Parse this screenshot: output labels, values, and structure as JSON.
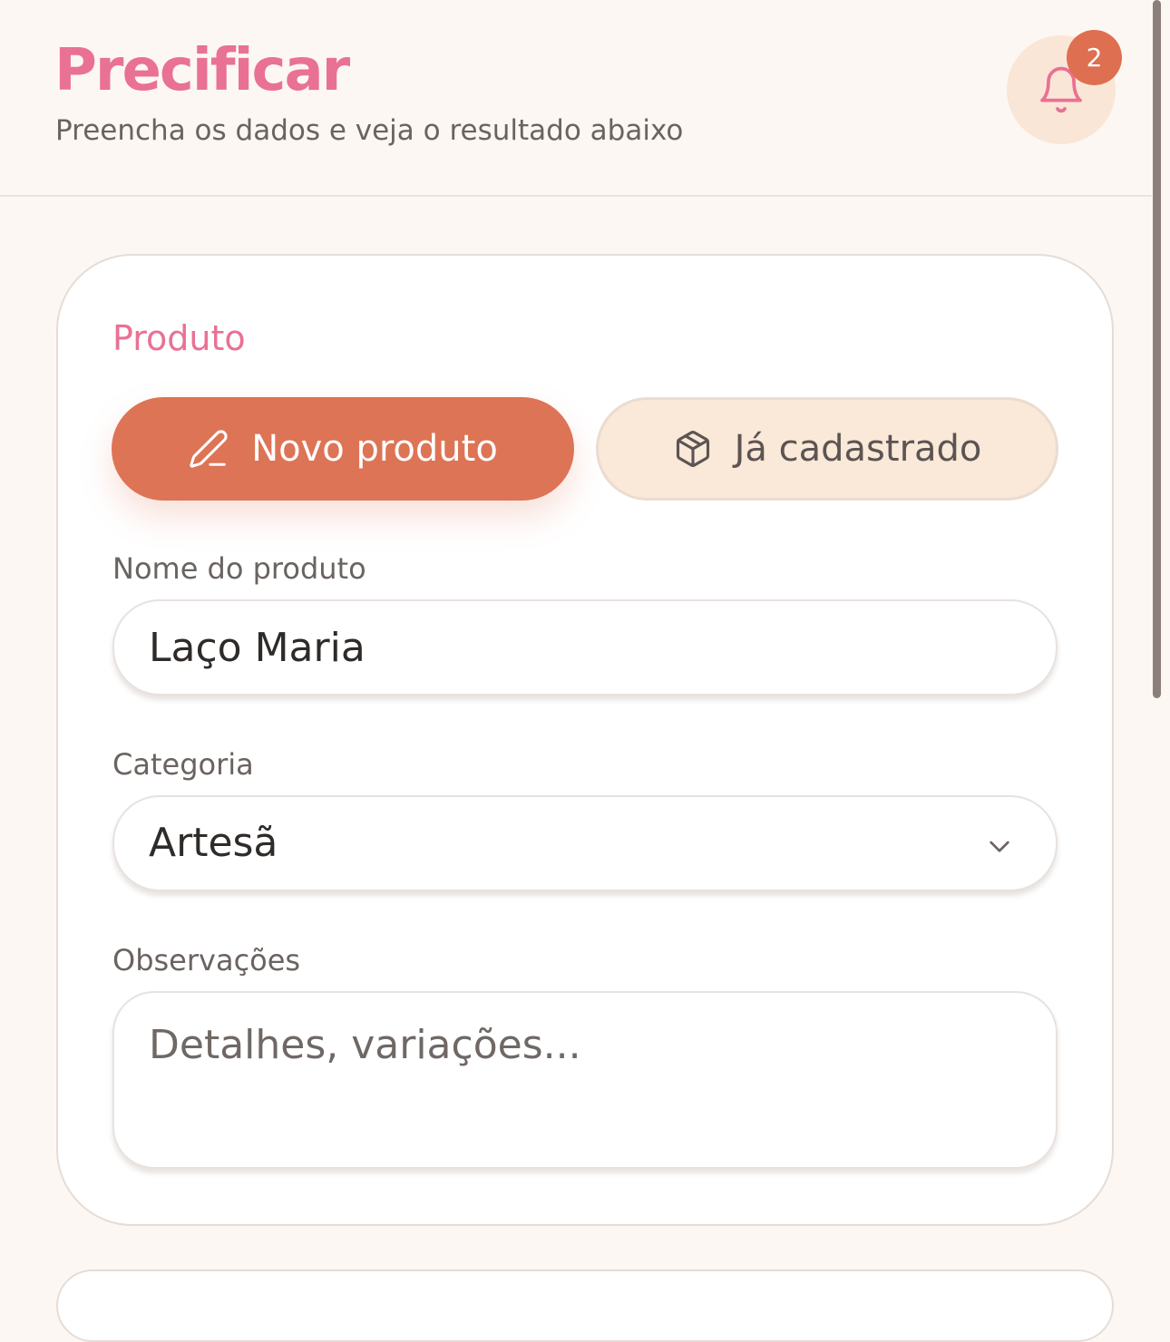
{
  "header": {
    "title": "Precificar",
    "subtitle": "Preencha os dados e veja o resultado abaixo",
    "notifications": {
      "icon": "bell-icon",
      "count": "2"
    }
  },
  "product_section": {
    "title": "Produto",
    "mode_toggle": {
      "new_label": "Novo produto",
      "new_icon": "pencil-icon",
      "existing_label": "Já cadastrado",
      "existing_icon": "package-icon",
      "selected": "new"
    },
    "name_field": {
      "label": "Nome do produto",
      "value": "Laço Maria"
    },
    "category_field": {
      "label": "Categoria",
      "value": "Artesã"
    },
    "notes_field": {
      "label": "Observações",
      "value": "",
      "placeholder": "Detalhes, variações..."
    }
  },
  "colors": {
    "brand_pink": "#e97194",
    "accent_orange": "#dd7455",
    "background": "#fcf7f3",
    "soft_peach": "#fae8d8"
  }
}
